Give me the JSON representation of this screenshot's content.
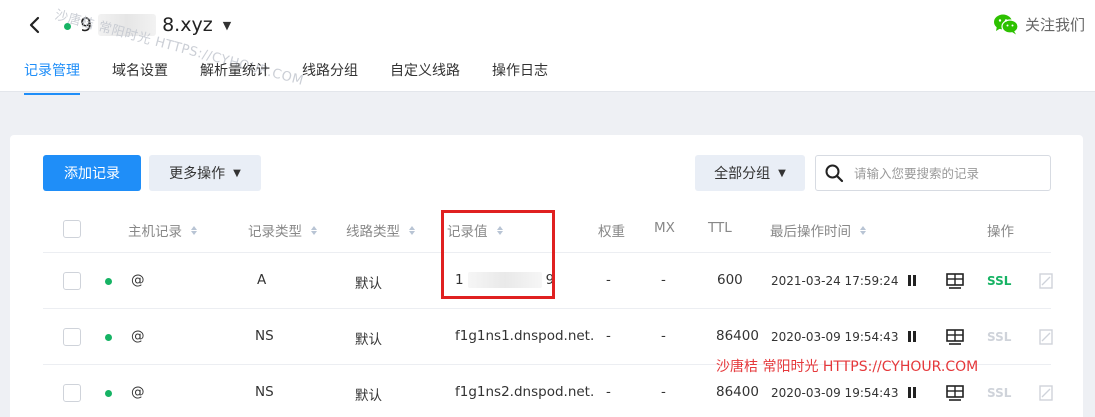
{
  "header": {
    "domain_prefix": "9",
    "domain_suffix": "8.xyz",
    "follow_label": "关注我们",
    "watermark": "沙唐桔 常阳时光 HTTPS://CYHOUR.COM"
  },
  "tabs": [
    {
      "label": "记录管理",
      "active": true
    },
    {
      "label": "域名设置"
    },
    {
      "label": "解析量统计"
    },
    {
      "label": "线路分组"
    },
    {
      "label": "自定义线路"
    },
    {
      "label": "操作日志"
    }
  ],
  "toolbar": {
    "add_record": "添加记录",
    "more_actions": "更多操作",
    "all_groups": "全部分组",
    "search_placeholder": "请输入您要搜索的记录"
  },
  "table": {
    "columns": {
      "host": "主机记录",
      "type": "记录类型",
      "line": "线路类型",
      "value": "记录值",
      "weight": "权重",
      "mx": "MX",
      "ttl": "TTL",
      "updated": "最后操作时间",
      "ops": "操作"
    },
    "rows": [
      {
        "host": "@",
        "type": "A",
        "line": "默认",
        "value_start": "1",
        "value_end": "9",
        "weight": "-",
        "mx": "-",
        "ttl": "600",
        "updated": "2021-03-24 17:59:24",
        "ssl": "SSL"
      },
      {
        "host": "@",
        "type": "NS",
        "line": "默认",
        "value": "f1g1ns1.dnspod.net.",
        "weight": "-",
        "mx": "-",
        "ttl": "86400",
        "updated": "2020-03-09 19:54:43",
        "ssl": "SSL"
      },
      {
        "host": "@",
        "type": "NS",
        "line": "默认",
        "value": "f1g1ns2.dnspod.net.",
        "weight": "-",
        "mx": "-",
        "ttl": "86400",
        "updated": "2020-03-09 19:54:43",
        "ssl": "SSL"
      }
    ]
  },
  "overlay_watermark": "沙唐桔 常阳时光 HTTPS://CYHOUR.COM",
  "colors": {
    "accent": "#1f8ef8",
    "status_green": "#16b364",
    "highlight_red": "#e02020"
  }
}
